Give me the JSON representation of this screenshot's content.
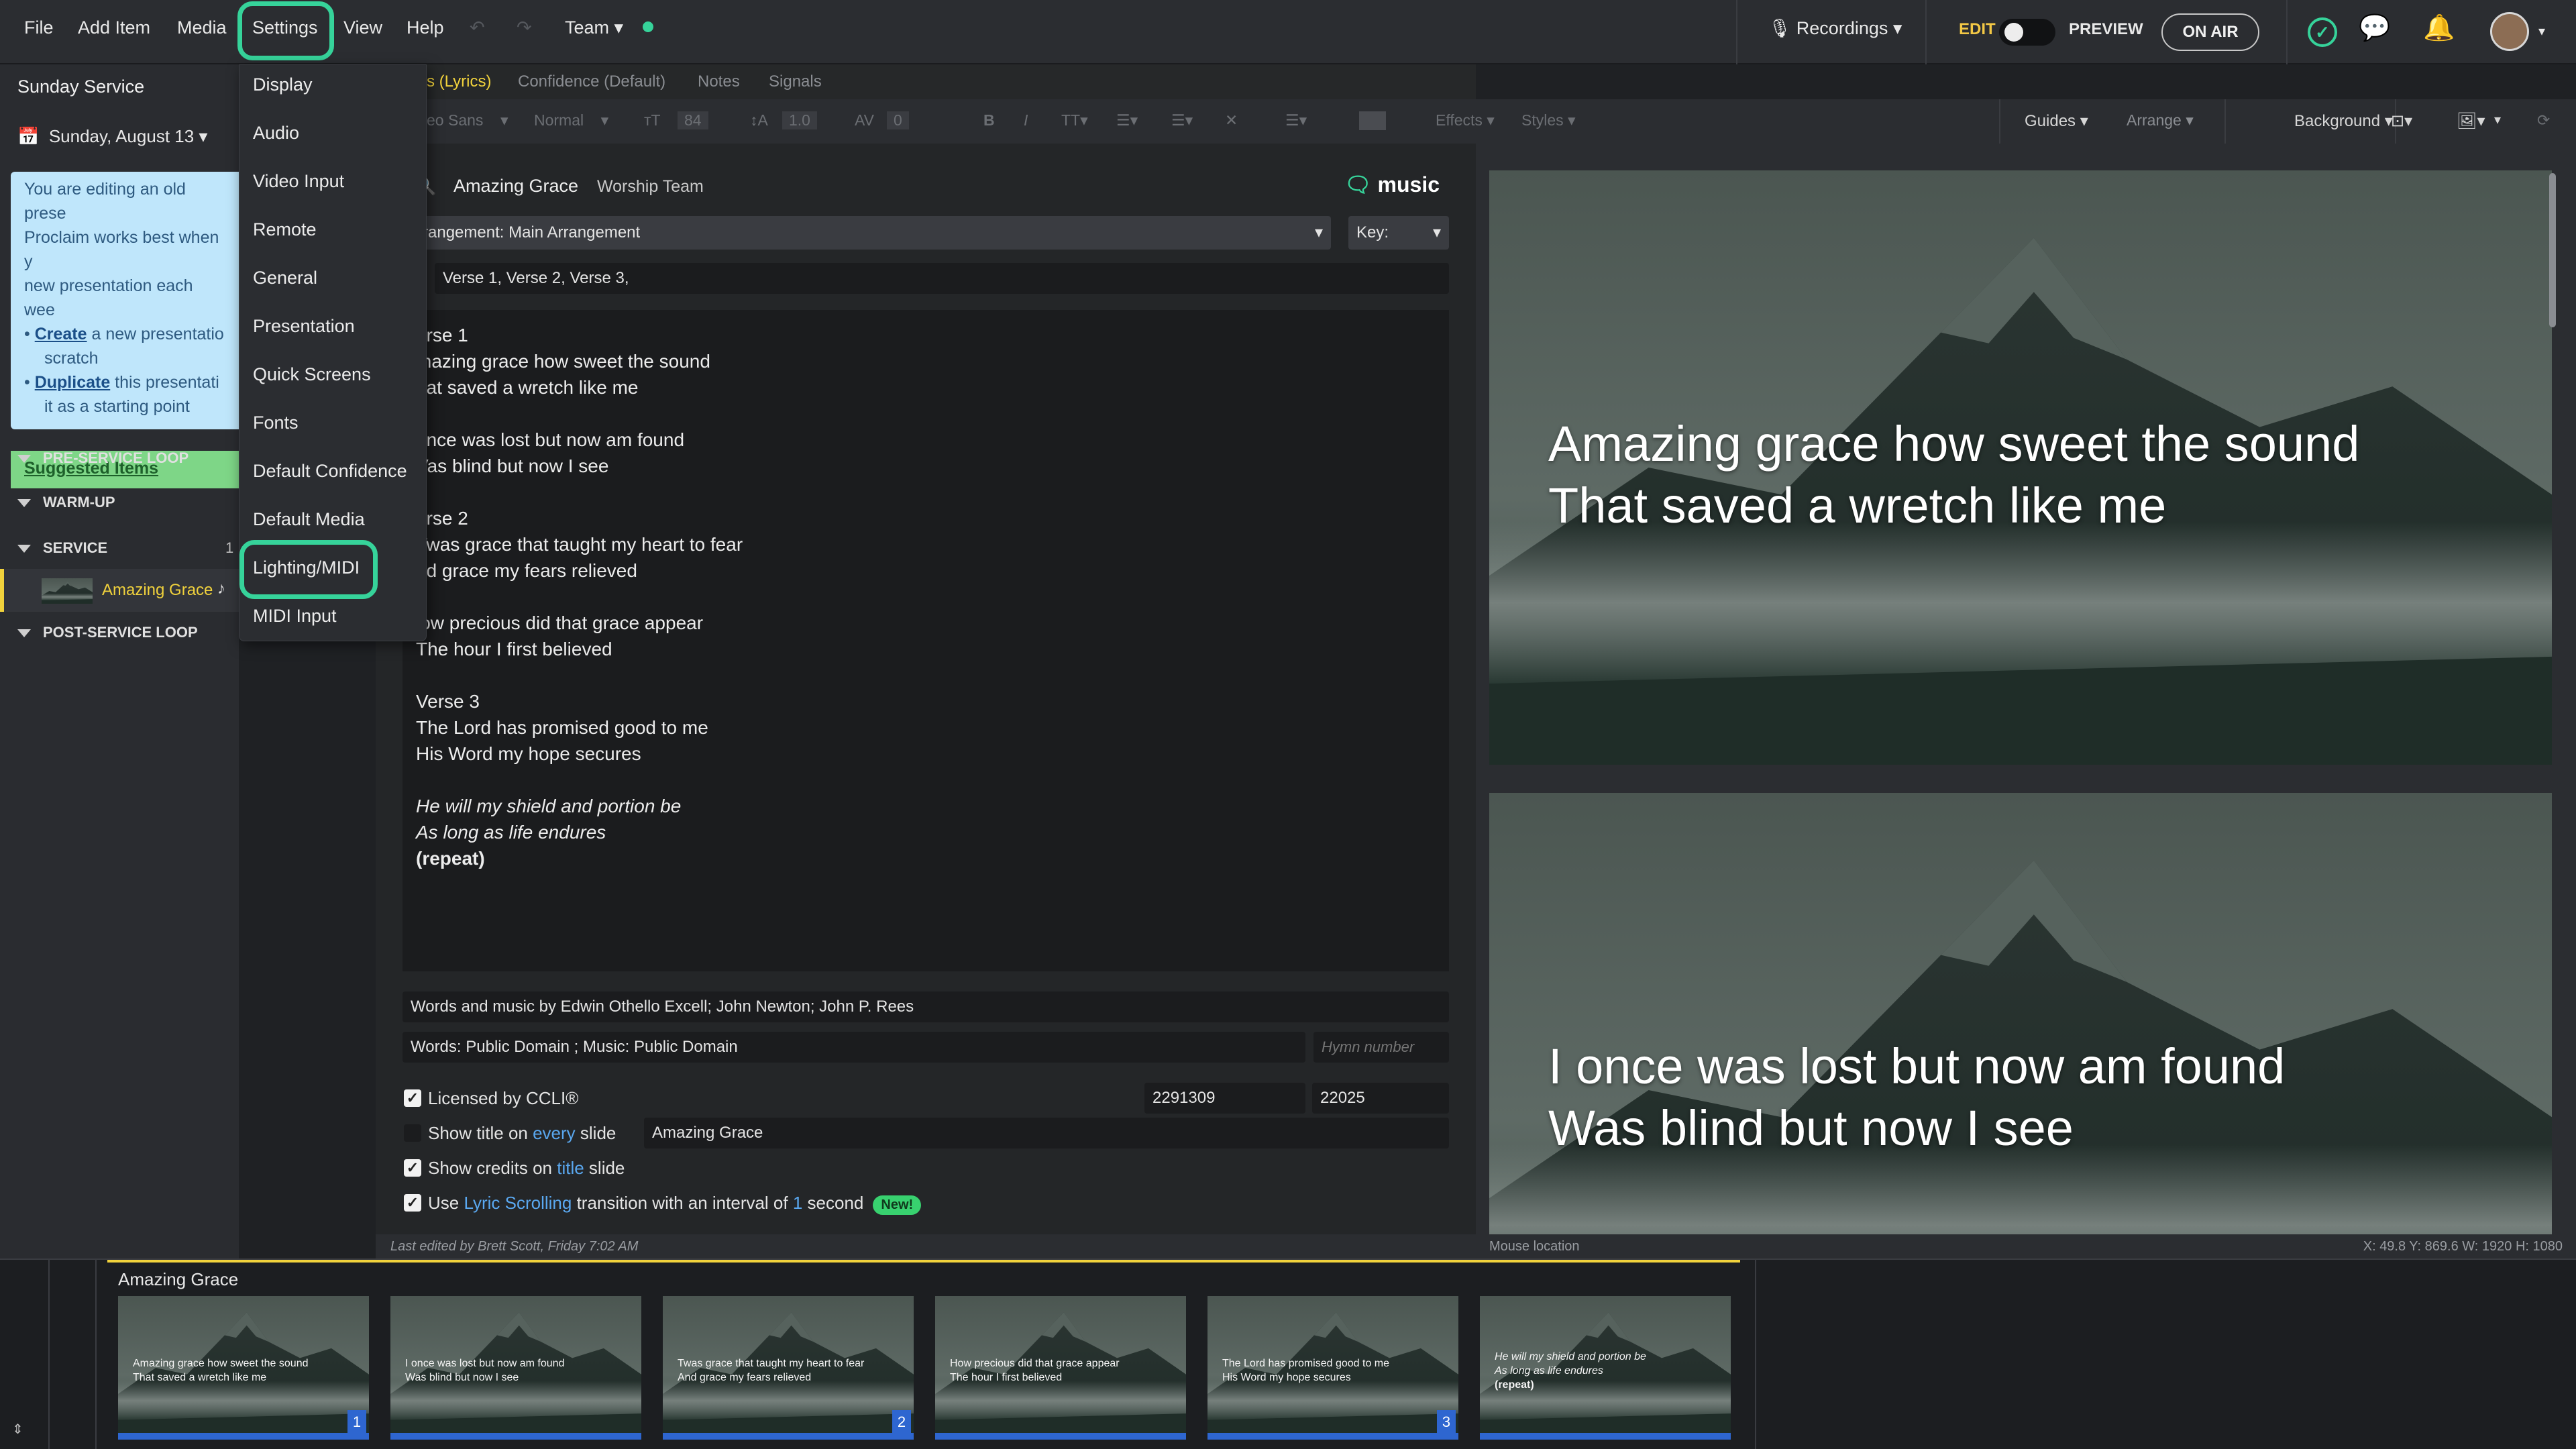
{
  "menubar": {
    "items": [
      "File",
      "Add Item",
      "Media",
      "Settings",
      "View",
      "Help"
    ],
    "team": "Team",
    "recordings": "Recordings",
    "edit": "EDIT",
    "preview": "PREVIEW",
    "on_air": "ON AIR"
  },
  "sidebar": {
    "service_name": "Sunday Service",
    "date": "Sunday, August 13",
    "note_line1": "You are editing an old prese",
    "note_line2": "Proclaim works best when y",
    "note_line3": "new presentation each wee",
    "note_create_link": "Create",
    "note_create_text": " a new presentatio",
    "note_create_text2": "scratch",
    "note_duplicate_link": "Duplicate",
    "note_duplicate_text": " this presentati",
    "note_duplicate_text2": "it as a starting point",
    "suggested": "Suggested Items",
    "sections": [
      "PRE-SERVICE LOOP",
      "WARM-UP",
      "SERVICE",
      "POST-SERVICE LOOP"
    ],
    "service_count": "1",
    "current_item": "Amazing Grace"
  },
  "settings_menu": {
    "items": [
      "Display",
      "Audio",
      "Video Input",
      "Remote",
      "General",
      "Presentation",
      "Quick Screens",
      "Fonts",
      "Default Confidence",
      "Default Media",
      "Lighting/MIDI",
      "MIDI Input"
    ]
  },
  "editor": {
    "tabs": [
      "s (Lyrics)",
      "Confidence (Default)",
      "Notes",
      "Signals"
    ],
    "font": "eo Sans",
    "weight": "Normal",
    "size": "84",
    "line_height": "1.0",
    "spacing": "0",
    "effects": "Effects",
    "styles": "Styles",
    "guides": "Guides",
    "arrange": "Arrange",
    "background": "Background",
    "song_title": "Amazing Grace",
    "song_team": "Worship Team",
    "music_brand": "music",
    "arrangement": "rangement: Main Arrangement",
    "key_label": "Key:",
    "order": "Verse 1, Verse 2, Verse 3,",
    "lyrics": [
      "erse 1",
      "mazing grace how sweet the sound",
      "hat saved a wretch like me",
      "",
      "once was lost but now am found",
      "Vas blind but now I see",
      "",
      "erse 2",
      "Twas grace that taught my heart to fear",
      "nd grace my fears relieved",
      "",
      "low precious did that grace appear",
      "The hour I first believed",
      "",
      "Verse 3",
      "The Lord has promised good to me",
      "His Word my hope secures",
      ""
    ],
    "lyrics_italic": [
      "He will my shield and portion be",
      "As long as life endures"
    ],
    "lyrics_bold": "(repeat)",
    "credits": "Words and music by Edwin Othello Excell; John Newton; John P. Rees",
    "copyright": "Words: Public Domain ; Music: Public Domain",
    "hymn_placeholder": "Hymn number",
    "ccli_label": "Licensed by CCLI®",
    "ccli_number": "2291309",
    "song_number": "22025",
    "show_title_pre": "Show title on ",
    "show_title_link": "every",
    "show_title_post": " slide",
    "show_title_value": "Amazing Grace",
    "show_credits_pre": "Show credits on ",
    "show_credits_link": "title",
    "show_credits_post": " slide",
    "scroll_pre": "Use ",
    "scroll_link": "Lyric Scrolling",
    "scroll_mid": " transition with an interval of ",
    "scroll_num": "1",
    "scroll_post": " second",
    "new_badge": "New!"
  },
  "preview": {
    "slide1": [
      "Amazing grace how sweet the sound",
      "That saved a wretch like me"
    ],
    "slide2": [
      "I once was lost but now am found",
      "Was blind but now I see"
    ]
  },
  "status": {
    "last_edited": "Last edited by Brett Scott, Friday 7:02 AM",
    "mouse": "Mouse location",
    "coords": "X: 49.8  Y: 869.6    W: 1920  H: 1080"
  },
  "timeline": {
    "title": "Amazing Grace",
    "thumbs": [
      {
        "l1": "Amazing grace how sweet the sound",
        "l2": "That saved a wretch like me",
        "num": "1"
      },
      {
        "l1": "I once was lost but now am found",
        "l2": "Was blind but now I see",
        "num": ""
      },
      {
        "l1": "Twas grace that taught my heart to fear",
        "l2": "And grace my fears relieved",
        "num": "2"
      },
      {
        "l1": "How precious did that grace appear",
        "l2": "The hour I first believed",
        "num": ""
      },
      {
        "l1": "The Lord has promised good to me",
        "l2": "His Word my hope secures",
        "num": "3"
      },
      {
        "l1": "He will my shield and portion be",
        "l2": "As long as life endures",
        "l3": "(repeat)",
        "num": ""
      }
    ]
  },
  "colors": {
    "accent_green": "#36d39a",
    "link_blue": "#5aa8f0",
    "slide_blue": "#2e66d0"
  }
}
